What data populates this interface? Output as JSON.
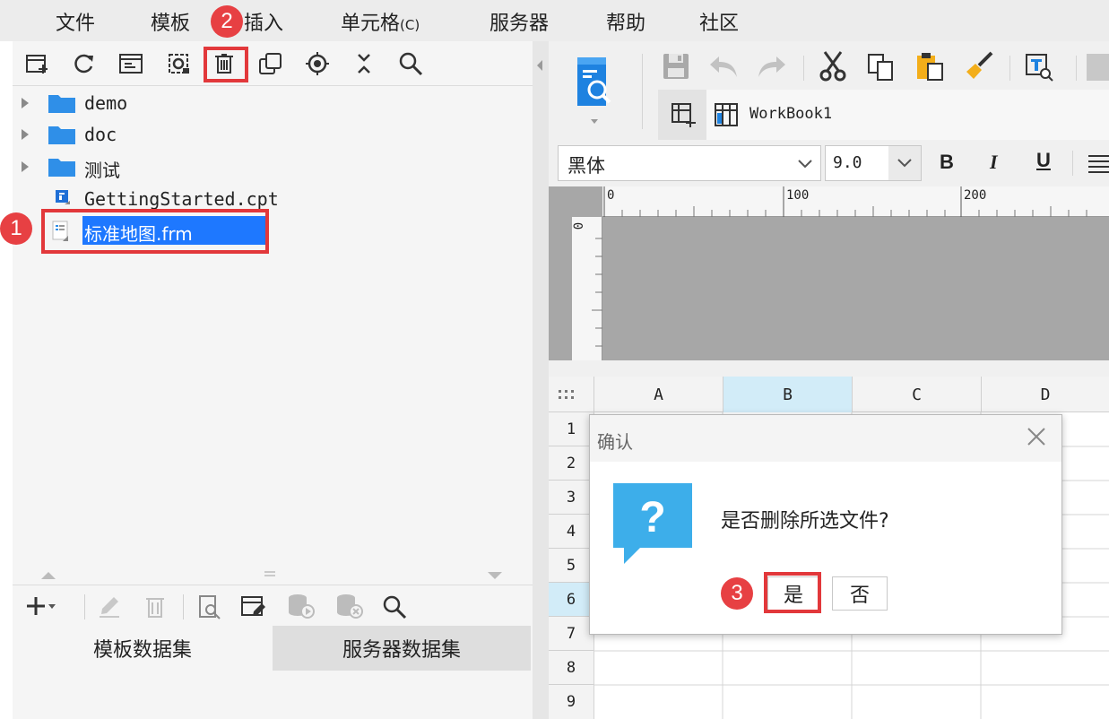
{
  "menu": {
    "items": [
      "文件",
      "模板",
      "插入",
      "单元格",
      "服务器",
      "帮助",
      "社区"
    ],
    "cell_shortcut": "(C)"
  },
  "left_toolbar": {
    "icons": [
      "new-folder-icon",
      "refresh-icon",
      "template-icon",
      "settings-icon",
      "delete-icon",
      "copy-icon",
      "locate-icon",
      "collapse-icon",
      "search-icon"
    ]
  },
  "tree": {
    "items": [
      {
        "label": "demo",
        "type": "folder"
      },
      {
        "label": "doc",
        "type": "folder"
      },
      {
        "label": "测试",
        "type": "folder"
      },
      {
        "label": "GettingStarted.cpt",
        "type": "cpt"
      },
      {
        "label": "标准地图.frm",
        "type": "frm",
        "selected": true
      }
    ]
  },
  "dataset_tabs": [
    "模板数据集",
    "服务器数据集"
  ],
  "workbook": {
    "tab_label": "WorkBook1"
  },
  "font": {
    "family": "黑体",
    "size": "9.0"
  },
  "format_buttons": {
    "bold": "B",
    "italic": "I",
    "underline": "U"
  },
  "ruler": {
    "h_ticks": [
      "0",
      "100",
      "200"
    ],
    "v_tick": "0"
  },
  "grid": {
    "columns": [
      "A",
      "B",
      "C",
      "D"
    ],
    "rows": [
      "1",
      "2",
      "3",
      "4",
      "5",
      "6",
      "7",
      "8",
      "9"
    ],
    "selected_column": "B",
    "selected_row": "6"
  },
  "dialog": {
    "title": "确认",
    "message": "是否删除所选文件?",
    "yes_label": "是",
    "no_label": "否",
    "question_mark": "?"
  },
  "callouts": [
    "1",
    "2",
    "3"
  ],
  "colors": {
    "accent": "#e2383b",
    "selection": "#1e78ff",
    "folder": "#2f8fe8",
    "dialog_icon": "#3daeea"
  }
}
